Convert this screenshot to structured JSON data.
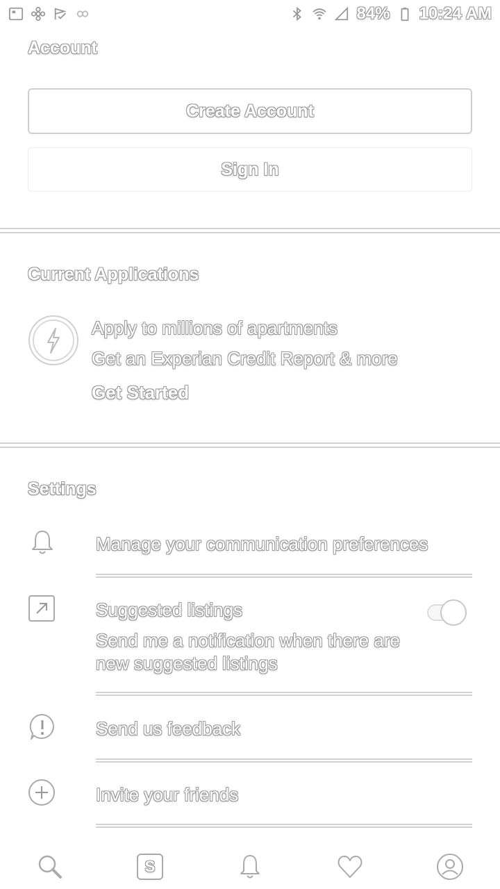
{
  "status_bar": {
    "battery": "84%",
    "time": "10:24 AM",
    "left_icons": [
      "gallery-icon",
      "pinwheel-icon",
      "flag-check-icon",
      "infinity-icon"
    ],
    "right_icons": [
      "bluetooth-icon",
      "wifi-icon",
      "signal-icon",
      "battery-icon"
    ]
  },
  "account": {
    "title": "Account",
    "create_label": "Create Account",
    "signin_label": "Sign In"
  },
  "applications": {
    "title": "Current Applications",
    "line1": "Apply to millions of apartments",
    "line2": "Get an Experian Credit Report & more",
    "cta": "Get Started",
    "icon": "lightning-bolt-icon"
  },
  "settings": {
    "title": "Settings",
    "items": [
      {
        "label": "Manage your communication preferences",
        "icon": "bell-icon"
      },
      {
        "label": "Suggested listings",
        "sub": "Send me a notification when there are new suggested listings",
        "icon": "arrow-up-right-icon",
        "toggle": false
      },
      {
        "label": "Send us feedback",
        "icon": "feedback-bubble-icon"
      },
      {
        "label": "Invite your friends",
        "icon": "add-friend-icon"
      }
    ]
  },
  "bottom_nav": [
    {
      "icon": "search-icon"
    },
    {
      "icon": "saved-searches-icon",
      "glyph": "S"
    },
    {
      "icon": "notifications-bell-icon"
    },
    {
      "icon": "favorites-heart-icon"
    },
    {
      "icon": "profile-icon"
    }
  ]
}
